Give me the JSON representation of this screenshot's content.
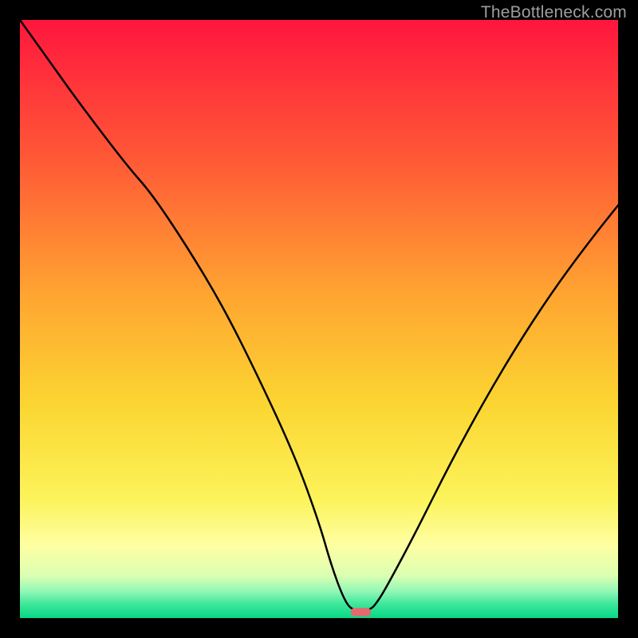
{
  "watermark": "TheBottleneck.com",
  "chart_data": {
    "type": "line",
    "title": "",
    "xlabel": "",
    "ylabel": "",
    "xlim": [
      0,
      100
    ],
    "ylim": [
      0,
      100
    ],
    "grid": false,
    "legend": false,
    "background_gradient_stops": [
      {
        "offset": 0.0,
        "color": "#ff163e"
      },
      {
        "offset": 0.24,
        "color": "#ff5b36"
      },
      {
        "offset": 0.46,
        "color": "#ffa531"
      },
      {
        "offset": 0.64,
        "color": "#fbd531"
      },
      {
        "offset": 0.8,
        "color": "#fcf35a"
      },
      {
        "offset": 0.88,
        "color": "#feffa4"
      },
      {
        "offset": 0.93,
        "color": "#d9ffb2"
      },
      {
        "offset": 0.956,
        "color": "#8ff7b7"
      },
      {
        "offset": 0.976,
        "color": "#3fe89b"
      },
      {
        "offset": 1.0,
        "color": "#06d885"
      }
    ],
    "series": [
      {
        "name": "bottleneck-curve",
        "color": "#000000",
        "x": [
          0,
          5,
          10,
          18,
          22,
          28,
          34,
          40,
          46,
          50,
          52,
          54,
          55.5,
          58.5,
          60,
          62,
          66,
          72,
          78,
          84,
          90,
          96,
          100
        ],
        "y": [
          100,
          93,
          86,
          75.5,
          71,
          62,
          52,
          40,
          27,
          16,
          9,
          3.5,
          1.2,
          1.2,
          3,
          6.5,
          14,
          26,
          37,
          47,
          56,
          64,
          69
        ]
      }
    ],
    "marker": {
      "name": "optimal-point",
      "x": 57,
      "y": 1.0,
      "width": 3.4,
      "height": 1.4,
      "color": "#e46a6f"
    }
  }
}
